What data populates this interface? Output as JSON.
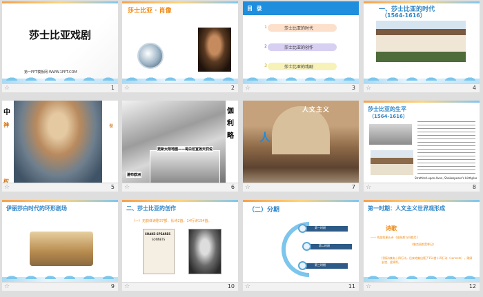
{
  "slides": [
    {
      "num": "1",
      "title": "莎士比亚戏剧",
      "subtitle": "第一PPT模板网-WWW.1PPT.COM"
    },
    {
      "num": "2",
      "title": "莎士比亚 · 肖像"
    },
    {
      "num": "3",
      "title": "目  录",
      "items": [
        {
          "no": "1",
          "label": "莎士比亚的时代"
        },
        {
          "no": "2",
          "label": "莎士比亚的创作"
        },
        {
          "no": "3",
          "label": "莎士比亚的戏剧"
        }
      ]
    },
    {
      "num": "4",
      "title_line1": "一、莎士比亚的时代",
      "title_line2": "（1564-1616）"
    },
    {
      "num": "5",
      "side_left": [
        "中",
        "神",
        "权"
      ],
      "side_right": [
        "世"
      ]
    },
    {
      "num": "6",
      "vertical_text": [
        "伽",
        "利",
        "略"
      ],
      "caption1": "更新太阳地图——哥白尼宣扬天罚说",
      "caption2": "遍布欧洲"
    },
    {
      "num": "7",
      "banner": "人文主义",
      "big_char": "人"
    },
    {
      "num": "8",
      "title_line1": "莎士比亚的生平",
      "title_line2": "（1564-1616）",
      "caption": "Stratford-upon-Avon, Shakespeare's birthplace"
    },
    {
      "num": "9",
      "title": "伊丽莎白时代的环形剧场"
    },
    {
      "num": "10",
      "title": "二、莎士比亚的创作",
      "subtitle": "（一）无韵体诗剧37部，长诗2首，14行诗154首。",
      "book_title": "SHAKE-SPEARES",
      "book_sub": "SONNETS"
    },
    {
      "num": "11",
      "title": "（二）分期",
      "periods": [
        "第一时期",
        "第二时期",
        "第三时期"
      ]
    },
    {
      "num": "12",
      "title": "第一时期：人文主义世界观形成",
      "sub": "诗歌",
      "line1": "——  两部叙事长诗   《维纳斯与阿都尼》",
      "line2": "《鲁克丽斯受辱记》",
      "line3": "抒情诗集有十四行诗，后来结集出版了154首十四行诗（sonnets），歌颂友谊、爱情等。"
    }
  ],
  "colors": {
    "accent": "#f08a14",
    "blue": "#2f86c8",
    "label_blue": "#1c6fb5"
  }
}
